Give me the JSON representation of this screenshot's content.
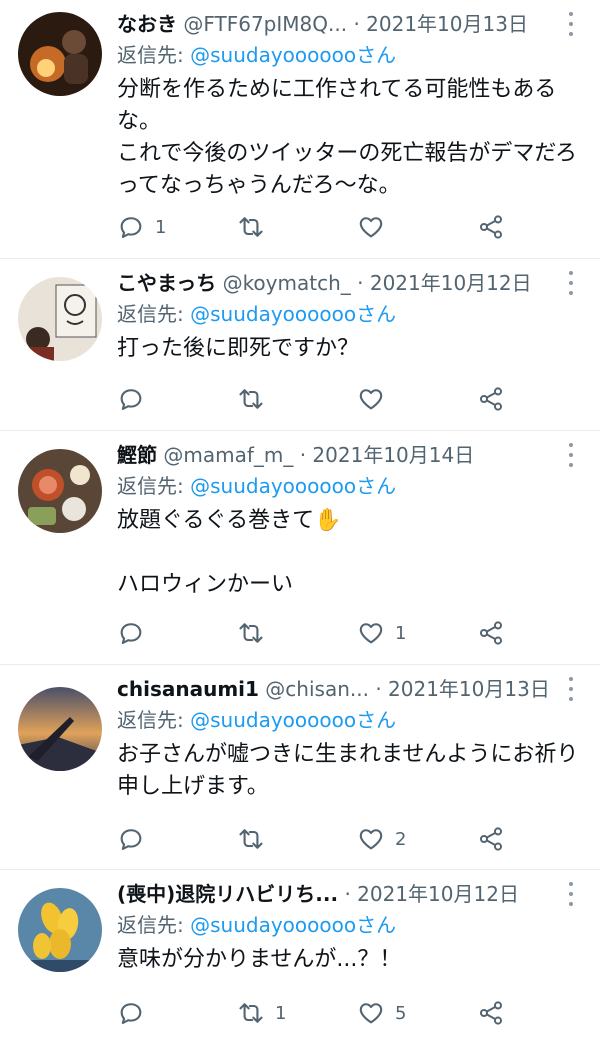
{
  "reply_prefix": "返信先: ",
  "tweets": [
    {
      "name": "なおき",
      "handle": "@FTF67pIM8Q...",
      "date": "· 2021年10月13日",
      "reply_to": "@suudayoooooo",
      "reply_suffix": "さん",
      "text": "分断を作るために工作されてる可能性もあるな。\nこれで今後のツイッターの死亡報告がデマだろってなっちゃうんだろ〜な。",
      "replies": "1",
      "retweets": "",
      "likes": ""
    },
    {
      "name": "こやまっち",
      "handle": "@koymatch_",
      "date": "· 2021年10月12日",
      "reply_to": "@suudayoooooo",
      "reply_suffix": "さん",
      "text": "打った後に即死ですか？",
      "replies": "",
      "retweets": "",
      "likes": ""
    },
    {
      "name": "鰹節",
      "handle": "@mamaf_m_",
      "date": "· 2021年10月14日",
      "reply_to": "@suudayoooooo",
      "reply_suffix": "さん",
      "text": "放題ぐるぐる巻きて✋\n\nハロウィンかーい",
      "replies": "",
      "retweets": "",
      "likes": "1"
    },
    {
      "name": "chisanaumi1",
      "handle": "@chisan...",
      "date": "· 2021年10月13日",
      "reply_to": "@suudayoooooo",
      "reply_suffix": "さん",
      "text": "お子さんが嘘つきに生まれませんようにお祈り申し上げます。",
      "replies": "",
      "retweets": "",
      "likes": "2"
    },
    {
      "name": "(喪中)退院リハビリち...",
      "handle": "",
      "date": "· 2021年10月12日",
      "reply_to": "@suudayoooooo",
      "reply_suffix": "さん",
      "text": "意味が分かりませんが...？！",
      "replies": "",
      "retweets": "1",
      "likes": "5"
    }
  ],
  "icons": {
    "reply": "reply-icon",
    "retweet": "retweet-icon",
    "like": "heart-icon",
    "share": "share-icon",
    "more": "more-icon"
  },
  "colors": {
    "link": "#1d9bf0",
    "muted": "#536471",
    "text": "#0f1419"
  }
}
